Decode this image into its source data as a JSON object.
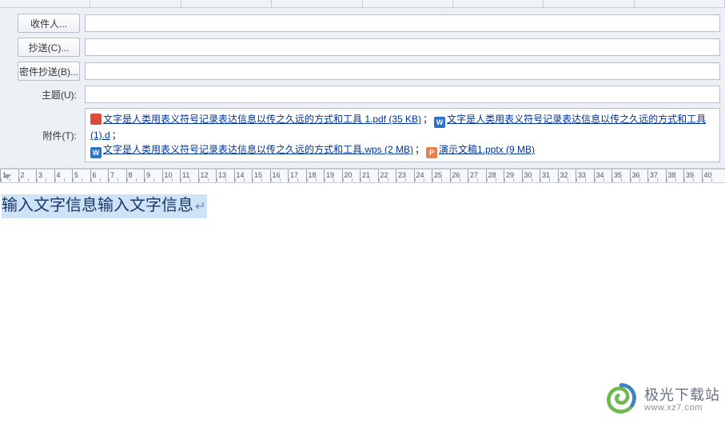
{
  "fields": {
    "recipient": {
      "label": "收件人...",
      "value": ""
    },
    "cc": {
      "label": "抄送(C)...",
      "value": ""
    },
    "bcc": {
      "label": "密件抄送(B)...",
      "value": ""
    },
    "subject": {
      "label": "主题(U):",
      "value": ""
    },
    "attach": {
      "label": "附件(T):"
    }
  },
  "attachments": [
    {
      "icon": "pdf",
      "name": "文字是人类用表义符号记录表达信息以传之久远的方式和工具 1.pdf (35 KB)"
    },
    {
      "icon": "doc",
      "name": "文字是人类用表义符号记录表达信息以传之久远的方式和工具(1).d"
    },
    {
      "icon": "wps",
      "name": "文字是人类用表义符号记录表达信息以传之久远的方式和工具.wps (2 MB)"
    },
    {
      "icon": "ppt",
      "name": "演示文稿1.pptx (9 MB)"
    }
  ],
  "ruler": {
    "start": 1,
    "end": 40
  },
  "body_text": "输入文字信息输入文字信息",
  "watermark": {
    "cn": "极光下载站",
    "url": "www.xz7.com"
  }
}
